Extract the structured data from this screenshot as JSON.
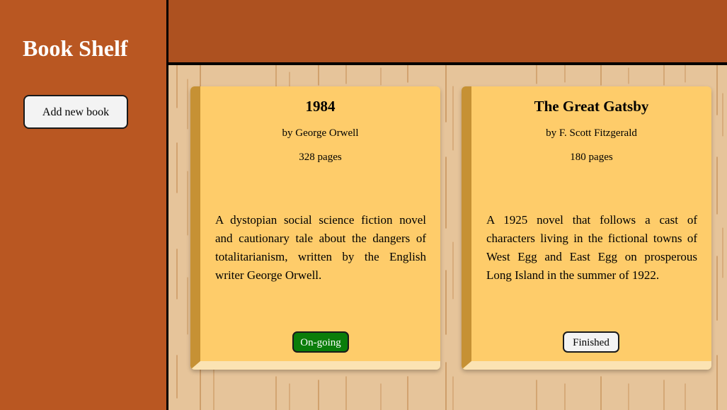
{
  "app": {
    "title": "Book Shelf"
  },
  "sidebar": {
    "add_button_label": "Add new book"
  },
  "books": [
    {
      "title": "1984",
      "author": "by George Orwell",
      "pages": "328 pages",
      "description": "A dystopian social science fiction novel and cautionary tale about the dangers of totalitarianism, written by the English writer George Orwell.",
      "status": "On-going"
    },
    {
      "title": "The Great Gatsby",
      "author": "by F. Scott Fitzgerald",
      "pages": "180 pages",
      "description": "A 1925 novel that follows a cast of characters living in the fictional towns of West Egg and East Egg on prosperous Long Island in the summer of 1922.",
      "status": "Finished"
    }
  ],
  "colors": {
    "sidebar": "#b95722",
    "header": "#ad5120",
    "wood": "#e6c49a",
    "card": "#fecc6a",
    "spine": "#c69134",
    "ongoing": "#0a7d0a",
    "finished": "#f3f3f3"
  }
}
